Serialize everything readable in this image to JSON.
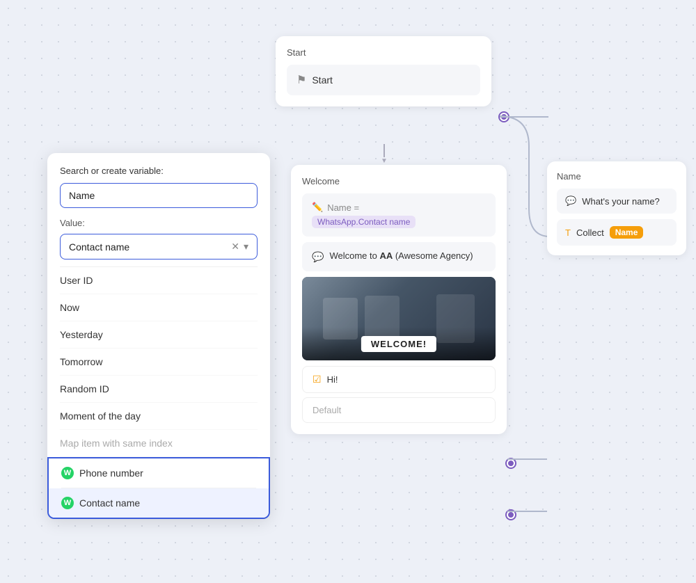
{
  "canvas": {
    "background": "#edf0f7"
  },
  "start_node": {
    "title": "Start",
    "inner_label": "Start"
  },
  "welcome_node": {
    "title": "Welcome",
    "name_row": {
      "prefix": "Name =",
      "tag": "WhatsApp.Contact name"
    },
    "welcome_text": "Welcome to AA (Awesome Agency)",
    "hi_text": "Hi!",
    "default_text": "Default"
  },
  "name_node": {
    "title": "Name",
    "message": "What's your name?",
    "collect_label": "Collect",
    "collect_badge": "Name"
  },
  "dropdown": {
    "search_label": "Search or create variable:",
    "search_value": "Name",
    "value_label": "Value:",
    "selected_value": "Contact name",
    "items": [
      {
        "label": "User ID"
      },
      {
        "label": "Now"
      },
      {
        "label": "Yesterday"
      },
      {
        "label": "Tomorrow"
      },
      {
        "label": "Random ID"
      },
      {
        "label": "Moment of the day"
      },
      {
        "label": "Map item with same index"
      }
    ],
    "whatsapp_items": [
      {
        "label": "Phone number"
      },
      {
        "label": "Contact name"
      }
    ]
  }
}
